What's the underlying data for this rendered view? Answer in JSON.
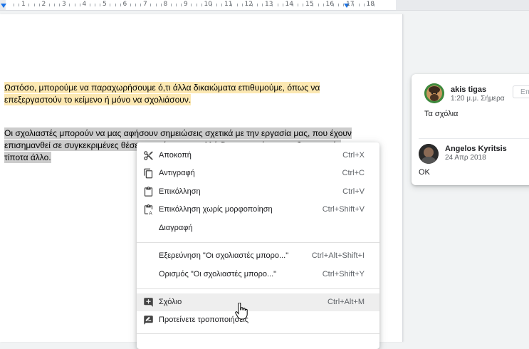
{
  "ruler": {
    "numbers": [
      "1",
      "2",
      "3",
      "4",
      "5",
      "6",
      "7",
      "8",
      "9",
      "10",
      "11",
      "12",
      "13",
      "14",
      "15",
      "16",
      "17",
      "18"
    ]
  },
  "document": {
    "paragraph1": "Ωστόσο, μπορούμε να παραχωρήσουμε ό,τι άλλα δικαιώματα επιθυμούμε, όπως να επεξεργαστούν το κείμενο ή μόνο να σχολιάσουν.",
    "paragraph2_line1": "Οι σχολιαστές μπορούν να μας αφήσουν σημειώσεις σχετικά με την εργασία μας, που έχουν",
    "paragraph2_line2": "επισημανθεί σε συγκεκριμένες θέσεις στο έγγραφο, αλλά δεν μπορούν να επεξεργαστούν",
    "paragraph2_line3": "τίποτα άλλο."
  },
  "comments": {
    "resolve_label": "Επ",
    "items": [
      {
        "author": "akis tigas",
        "time": "1:20 μ.μ. Σήμερα",
        "text": "Τα σχόλια"
      },
      {
        "author": "Angelos Kyritsis",
        "time": "24 Απρ 2018",
        "text": "OK"
      }
    ]
  },
  "context_menu": {
    "items": [
      {
        "label": "Αποκοπή",
        "shortcut": "Ctrl+X",
        "icon": "scissors-icon"
      },
      {
        "label": "Αντιγραφή",
        "shortcut": "Ctrl+C",
        "icon": "copy-icon"
      },
      {
        "label": "Επικόλληση",
        "shortcut": "Ctrl+V",
        "icon": "clipboard-icon"
      },
      {
        "label": "Επικόλληση χωρίς μορφοποίηση",
        "shortcut": "Ctrl+Shift+V",
        "icon": "paste-plain-icon"
      },
      {
        "label": "Διαγραφή",
        "shortcut": ""
      },
      {
        "label": "Εξερεύνηση \"Οι σχολιαστές μπορο...\"",
        "shortcut": "Ctrl+Alt+Shift+I"
      },
      {
        "label": "Ορισμός \"Οι σχολιαστές μπορο...\"",
        "shortcut": "Ctrl+Shift+Y"
      },
      {
        "label": "Σχόλιο",
        "shortcut": "Ctrl+Alt+M",
        "icon": "add-comment-icon"
      },
      {
        "label": "Προτείνετε τροποποιήσεις",
        "shortcut": "",
        "icon": "suggest-edits-icon"
      }
    ]
  },
  "colors": {
    "highlight_yellow": "#fce8b2",
    "selection_grey": "#cccccc",
    "accent_blue": "#1a73e8"
  }
}
